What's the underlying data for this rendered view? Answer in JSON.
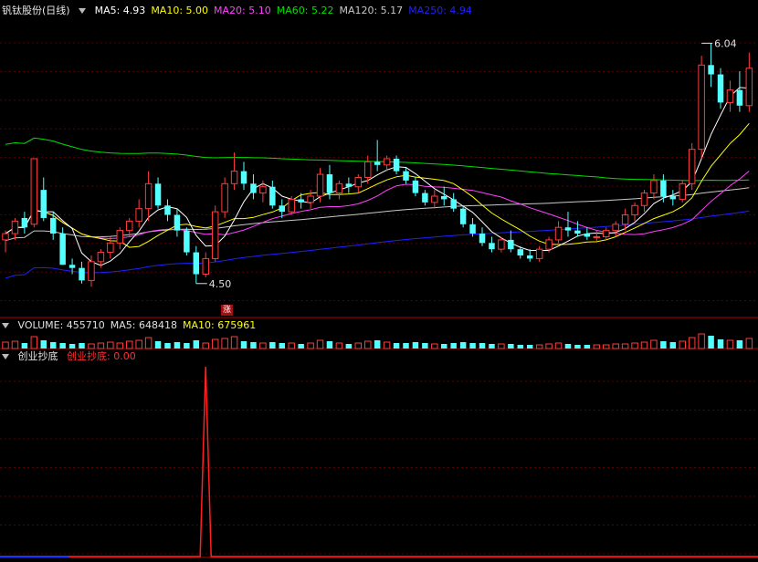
{
  "header": {
    "stock_name": "钒钛股份(日线)",
    "ma_labels": [
      {
        "text": "MA5: 4.93",
        "color": "#ffffff"
      },
      {
        "text": "MA10: 5.00",
        "color": "#ffff00"
      },
      {
        "text": "MA20: 5.10",
        "color": "#ff40ff"
      },
      {
        "text": "MA60: 5.22",
        "color": "#00e000"
      },
      {
        "text": "MA120: 5.17",
        "color": "#c8c8c8"
      },
      {
        "text": "MA250: 4.94",
        "color": "#2020ff"
      }
    ]
  },
  "volume_header": {
    "items": [
      {
        "text": "VOLUME: 455710",
        "color": "#e0e0e0"
      },
      {
        "text": "MA5: 648418",
        "color": "#e0e0e0"
      },
      {
        "text": "MA10: 675961",
        "color": "#ffff00"
      }
    ]
  },
  "indicator_header": {
    "name": "创业抄底",
    "value_text": "创业抄底: 0.00",
    "value_color": "#ff3030"
  },
  "badge_text": "涨",
  "colors": {
    "up": "#ff3c3c",
    "down": "#54ffff",
    "grid": "#5a0000",
    "signal": "#ff2020"
  },
  "chart_data": {
    "type": "candlestick",
    "ylim": [
      4.3,
      6.2
    ],
    "annotations": [
      {
        "label": "6.04",
        "index": 73,
        "value": 6.04
      },
      {
        "label": "4.50",
        "index": 20,
        "value": 4.5
      }
    ],
    "ohlc": [
      [
        4.78,
        4.84,
        4.7,
        4.82
      ],
      [
        4.82,
        4.92,
        4.78,
        4.9
      ],
      [
        4.92,
        4.96,
        4.82,
        4.86
      ],
      [
        4.88,
        5.3,
        4.86,
        5.3
      ],
      [
        5.1,
        5.18,
        4.9,
        4.92
      ],
      [
        4.92,
        4.96,
        4.78,
        4.82
      ],
      [
        4.82,
        4.86,
        4.62,
        4.62
      ],
      [
        4.62,
        4.66,
        4.56,
        4.6
      ],
      [
        4.6,
        4.64,
        4.5,
        4.52
      ],
      [
        4.52,
        4.68,
        4.48,
        4.64
      ],
      [
        4.64,
        4.72,
        4.6,
        4.7
      ],
      [
        4.7,
        4.8,
        4.66,
        4.76
      ],
      [
        4.76,
        4.86,
        4.72,
        4.84
      ],
      [
        4.84,
        4.92,
        4.8,
        4.9
      ],
      [
        4.9,
        5.04,
        4.86,
        4.98
      ],
      [
        4.98,
        5.22,
        4.9,
        5.14
      ],
      [
        5.14,
        5.18,
        4.98,
        5.0
      ],
      [
        5.0,
        5.04,
        4.9,
        4.94
      ],
      [
        4.94,
        4.98,
        4.8,
        4.84
      ],
      [
        4.84,
        4.86,
        4.68,
        4.7
      ],
      [
        4.7,
        4.74,
        4.5,
        4.56
      ],
      [
        4.56,
        4.7,
        4.54,
        4.66
      ],
      [
        4.66,
        5.0,
        4.64,
        4.96
      ],
      [
        4.96,
        5.18,
        4.92,
        5.14
      ],
      [
        5.14,
        5.34,
        5.1,
        5.22
      ],
      [
        5.22,
        5.28,
        5.1,
        5.14
      ],
      [
        5.14,
        5.2,
        5.04,
        5.08
      ],
      [
        5.08,
        5.16,
        5.02,
        5.12
      ],
      [
        5.12,
        5.16,
        4.98,
        5.0
      ],
      [
        5.0,
        5.04,
        4.92,
        4.96
      ],
      [
        4.96,
        5.06,
        4.94,
        5.04
      ],
      [
        5.04,
        5.08,
        4.98,
        5.02
      ],
      [
        5.02,
        5.1,
        4.98,
        5.06
      ],
      [
        5.06,
        5.24,
        5.02,
        5.2
      ],
      [
        5.2,
        5.26,
        5.04,
        5.08
      ],
      [
        5.08,
        5.16,
        5.04,
        5.14
      ],
      [
        5.14,
        5.18,
        5.08,
        5.12
      ],
      [
        5.12,
        5.2,
        5.08,
        5.18
      ],
      [
        5.18,
        5.32,
        5.14,
        5.28
      ],
      [
        5.28,
        5.42,
        5.22,
        5.26
      ],
      [
        5.26,
        5.32,
        5.22,
        5.3
      ],
      [
        5.3,
        5.32,
        5.2,
        5.22
      ],
      [
        5.22,
        5.24,
        5.14,
        5.16
      ],
      [
        5.16,
        5.18,
        5.06,
        5.08
      ],
      [
        5.08,
        5.1,
        5.0,
        5.02
      ],
      [
        5.02,
        5.1,
        4.98,
        5.06
      ],
      [
        5.06,
        5.12,
        5.0,
        5.04
      ],
      [
        5.04,
        5.08,
        4.96,
        4.98
      ],
      [
        4.98,
        5.0,
        4.86,
        4.88
      ],
      [
        4.88,
        4.92,
        4.8,
        4.82
      ],
      [
        4.82,
        4.86,
        4.74,
        4.76
      ],
      [
        4.76,
        4.8,
        4.7,
        4.72
      ],
      [
        4.72,
        4.8,
        4.7,
        4.78
      ],
      [
        4.78,
        4.84,
        4.7,
        4.72
      ],
      [
        4.72,
        4.74,
        4.66,
        4.68
      ],
      [
        4.68,
        4.72,
        4.64,
        4.66
      ],
      [
        4.66,
        4.74,
        4.64,
        4.72
      ],
      [
        4.72,
        4.8,
        4.7,
        4.78
      ],
      [
        4.78,
        4.9,
        4.76,
        4.86
      ],
      [
        4.86,
        4.96,
        4.8,
        4.84
      ],
      [
        4.84,
        4.9,
        4.8,
        4.82
      ],
      [
        4.82,
        4.86,
        4.78,
        4.8
      ],
      [
        4.8,
        4.84,
        4.76,
        4.8
      ],
      [
        4.8,
        4.86,
        4.78,
        4.84
      ],
      [
        4.84,
        4.9,
        4.8,
        4.88
      ],
      [
        4.88,
        4.98,
        4.84,
        4.94
      ],
      [
        4.94,
        5.02,
        4.9,
        5.0
      ],
      [
        5.0,
        5.1,
        4.96,
        5.08
      ],
      [
        5.08,
        5.2,
        5.04,
        5.16
      ],
      [
        5.16,
        5.2,
        5.02,
        5.06
      ],
      [
        5.06,
        5.1,
        5.0,
        5.04
      ],
      [
        5.04,
        5.16,
        5.02,
        5.14
      ],
      [
        5.14,
        5.4,
        5.1,
        5.36
      ],
      [
        5.36,
        5.96,
        5.3,
        5.9
      ],
      [
        5.9,
        6.04,
        5.76,
        5.84
      ],
      [
        5.84,
        5.88,
        5.62,
        5.66
      ],
      [
        5.66,
        5.8,
        5.6,
        5.74
      ],
      [
        5.74,
        5.86,
        5.6,
        5.64
      ],
      [
        5.64,
        5.98,
        5.6,
        5.88
      ]
    ],
    "volume_relative": [
      0.7,
      0.8,
      0.6,
      1.3,
      0.9,
      0.7,
      0.6,
      0.5,
      0.6,
      0.5,
      0.6,
      0.7,
      0.6,
      0.8,
      0.9,
      1.2,
      0.8,
      0.6,
      0.7,
      0.6,
      0.9,
      0.6,
      1.0,
      1.1,
      1.3,
      0.8,
      0.7,
      0.6,
      0.7,
      0.6,
      0.6,
      0.5,
      0.6,
      0.9,
      0.8,
      0.6,
      0.5,
      0.6,
      0.8,
      0.9,
      0.7,
      0.6,
      0.6,
      0.7,
      0.6,
      0.5,
      0.5,
      0.6,
      0.7,
      0.6,
      0.6,
      0.5,
      0.5,
      0.5,
      0.4,
      0.4,
      0.4,
      0.5,
      0.6,
      0.5,
      0.4,
      0.4,
      0.4,
      0.4,
      0.5,
      0.5,
      0.6,
      0.7,
      0.9,
      0.8,
      0.7,
      0.8,
      1.2,
      1.6,
      1.4,
      1.0,
      0.9,
      0.9,
      1.1
    ],
    "indicator": {
      "name": "创业抄底",
      "signal_index": 21,
      "signal_value": 1
    }
  }
}
